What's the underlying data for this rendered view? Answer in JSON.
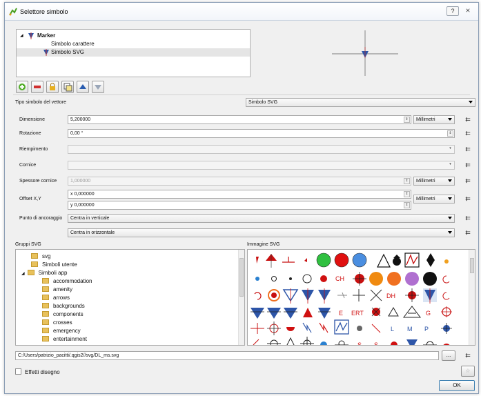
{
  "window": {
    "title": "Selettore simbolo"
  },
  "tree": {
    "root": "Marker",
    "children": [
      "Simbolo carattere",
      "Simbolo SVG"
    ]
  },
  "symbol_layer_type": {
    "label": "Tipo simbolo del vettore",
    "value": "Simbolo SVG"
  },
  "fields": {
    "size": {
      "label": "Dimensione",
      "value": "5,200000",
      "unit": "Millimetri"
    },
    "rotation": {
      "label": "Rotazione",
      "value": "0,00 °"
    },
    "fill": {
      "label": "Riempimento"
    },
    "outline": {
      "label": "Cornice"
    },
    "outline_width": {
      "label": "Spessore cornice",
      "value": "1,000000",
      "unit": "Millimetri"
    },
    "offset": {
      "label": "Offset X,Y",
      "x": "x 0,000000",
      "y": "y 0,000000",
      "unit": "Millimetri"
    },
    "anchor": {
      "label": "Punto di ancoraggio",
      "vertical": "Centra in verticale",
      "horizontal": "Centra in orizzontale"
    }
  },
  "svg_groups": {
    "label": "Gruppi SVG",
    "items": [
      "svg",
      "Simboli utente",
      "Simboli app",
      "accommodation",
      "amenity",
      "arrows",
      "backgrounds",
      "components",
      "crosses",
      "emergency",
      "entertainment"
    ]
  },
  "svg_images": {
    "label": "Immagine SVG",
    "text_glyphs": {
      "ch": "CH",
      "dh": "DH",
      "e": "E",
      "ert": "ERT",
      "g": "G",
      "l": "L",
      "m": "M",
      "p": "P",
      "s": "S"
    }
  },
  "path": {
    "value": "C:/Users/patrizio_pacitti/.qgis2//svg/DL_ms.svg",
    "browse": "..."
  },
  "footer": {
    "effects": "Effetti disegno",
    "ok": "OK"
  },
  "icons": {
    "help": "?",
    "close": "⨯",
    "datadefined": "⇇"
  },
  "colors": {
    "accent": "#3b5a99",
    "marker": "#1c4fa0",
    "selection": "#e5e5e5"
  }
}
